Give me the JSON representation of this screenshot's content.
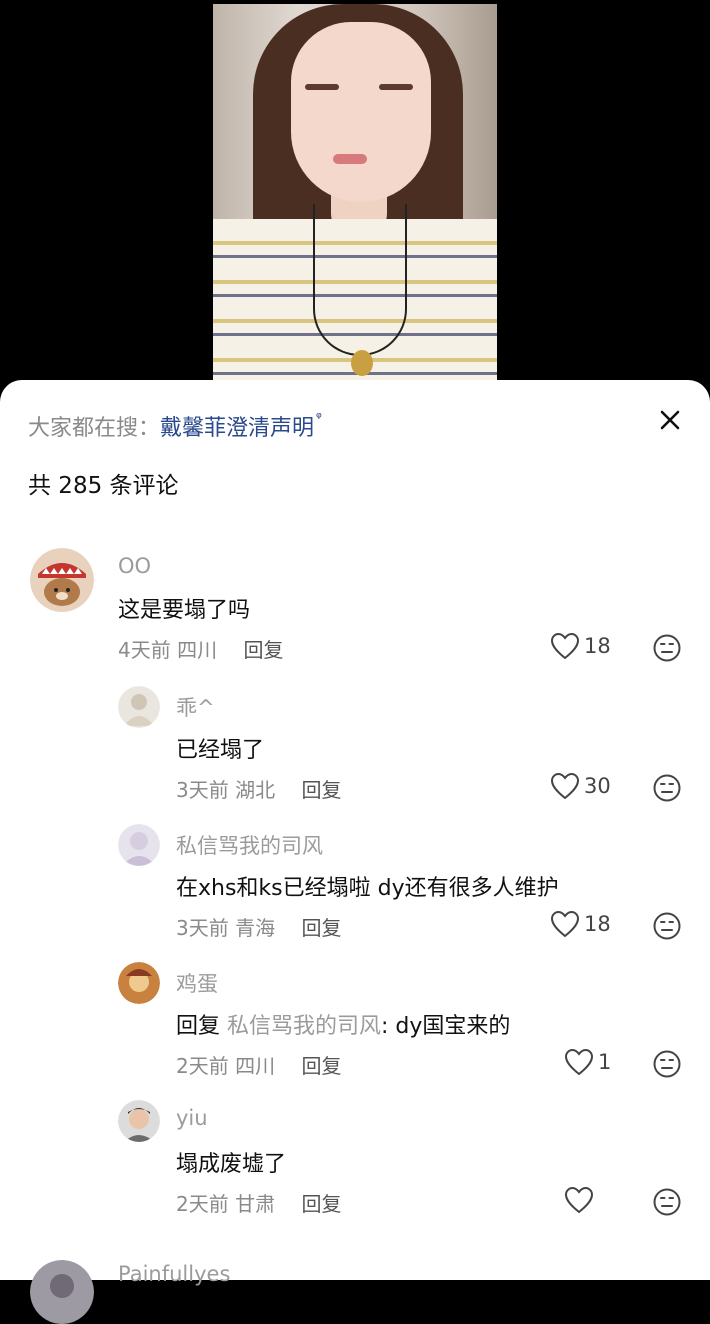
{
  "search": {
    "prefix": "大家都在搜：",
    "term": "戴馨菲澄清声明",
    "icon": "search-icon"
  },
  "comments_header": {
    "count_label": "共 285 条评论"
  },
  "comments": [
    {
      "user": "OO",
      "text": "这是要塌了吗",
      "time": "4天前",
      "location": "四川",
      "reply_label": "回复",
      "likes": "18"
    },
    {
      "user": "乖^",
      "text": "已经塌了",
      "time": "3天前",
      "location": "湖北",
      "reply_label": "回复",
      "likes": "30"
    },
    {
      "user": "私信骂我的司风",
      "text": "在xhs和ks已经塌啦 dy还有很多人维护",
      "time": "3天前",
      "location": "青海",
      "reply_label": "回复",
      "likes": "18"
    },
    {
      "user": "鸡蛋",
      "reply_prefix": "回复",
      "reply_target": "私信骂我的司风",
      "text": ": dy国宝来的",
      "time": "2天前",
      "location": "四川",
      "reply_label": "回复",
      "likes": "1"
    },
    {
      "user": "yiu",
      "text": "塌成废墟了",
      "time": "2天前",
      "location": "甘肃",
      "reply_label": "回复",
      "likes": ""
    }
  ],
  "partial_next": {
    "user": "Painfullyes"
  },
  "colors": {
    "link": "#2a4a8c",
    "muted": "#8a8a8a",
    "background": "#ffffff"
  }
}
